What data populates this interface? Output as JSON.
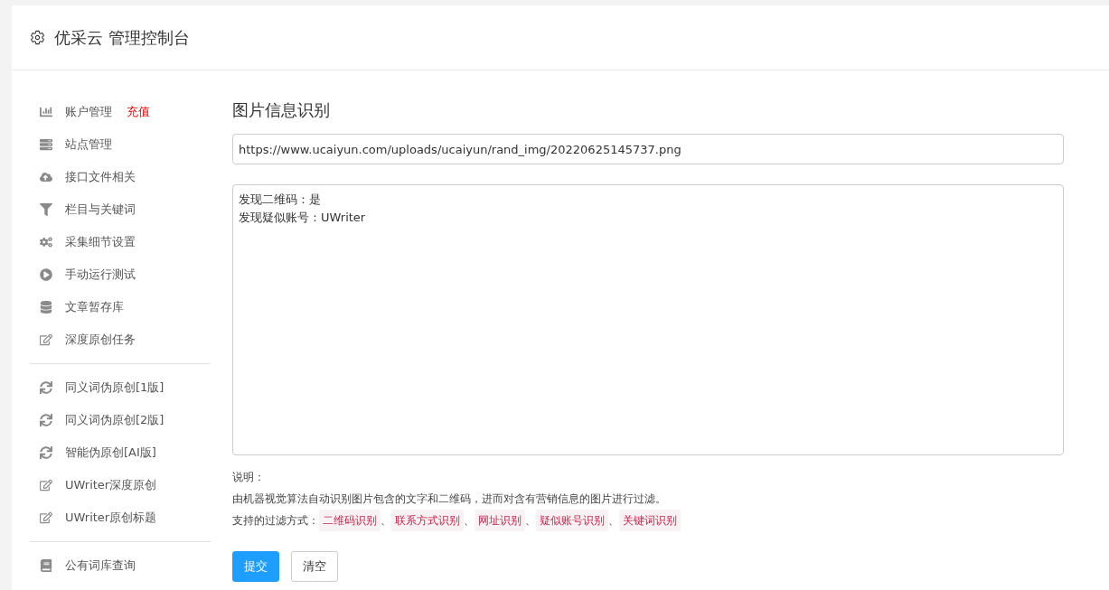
{
  "header": {
    "title": "优采云 管理控制台"
  },
  "sidebar": {
    "sections": [
      [
        {
          "label": "账户管理",
          "badge": "充值"
        },
        {
          "label": "站点管理"
        },
        {
          "label": "接口文件相关"
        },
        {
          "label": "栏目与关键词"
        },
        {
          "label": "采集细节设置"
        },
        {
          "label": "手动运行测试"
        },
        {
          "label": "文章暂存库"
        },
        {
          "label": "深度原创任务"
        }
      ],
      [
        {
          "label": "同义词伪原创[1版]"
        },
        {
          "label": "同义词伪原创[2版]"
        },
        {
          "label": "智能伪原创[AI版]"
        },
        {
          "label": "UWriter深度原创"
        },
        {
          "label": "UWriter原创标题"
        }
      ],
      [
        {
          "label": "公有词库查询"
        }
      ]
    ]
  },
  "main": {
    "title": "图片信息识别",
    "url_field": {
      "value": "https://www.ucaiyun.com/uploads/ucaiyun/rand_img/20220625145737.png"
    },
    "result_box": {
      "lines": [
        "发现二维码：是",
        "发现疑似账号：UWriter"
      ]
    },
    "notes_heading": "说明：",
    "description": "由机器视觉算法自动识别图片包含的文字和二维码，进而对含有营销信息的图片进行过滤。",
    "filters_label": "支持的过滤方式：",
    "filters": [
      "二维码识别",
      "联系方式识别",
      "网址识别",
      "疑似账号识别",
      "关键词识别"
    ],
    "separator": "、",
    "buttons": [
      {
        "label": "提交",
        "kind": "primary"
      },
      {
        "label": "清空",
        "kind": "default"
      }
    ]
  }
}
